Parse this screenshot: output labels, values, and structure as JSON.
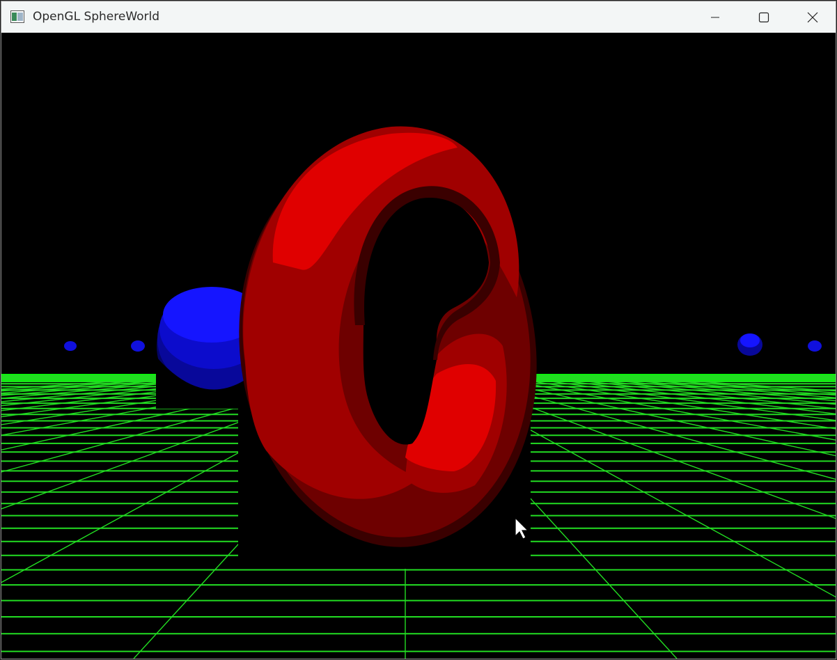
{
  "window": {
    "title": "OpenGL SphereWorld",
    "controls": {
      "minimize_icon": "minimize-icon",
      "maximize_icon": "maximize-icon",
      "close_icon": "close-icon"
    }
  },
  "scene": {
    "background_color": "#000000",
    "floor_grid_color": "#22dd22",
    "floor_horizon_color": "#00ff00",
    "torus_colors": [
      "#e00000",
      "#a00000",
      "#6e0000",
      "#3a0000"
    ],
    "sphere_colors": [
      "#1515ff",
      "#0c0ccc",
      "#08089a",
      "#040466"
    ],
    "cursor_icon": "arrow-cursor-icon"
  }
}
